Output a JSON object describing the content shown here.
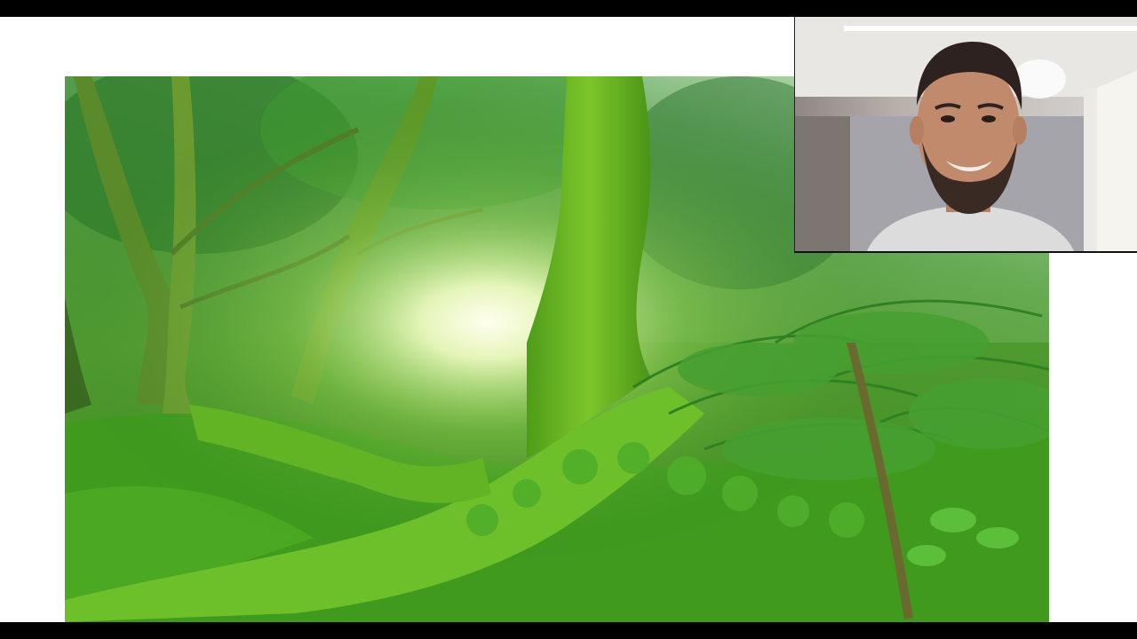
{
  "colors": {
    "letterbox": "#000000",
    "slide_background": "#ffffff",
    "moss": "#5fae1f",
    "fern": "#3f8f2a",
    "light": "#fffbe0"
  },
  "slide": {
    "image": "mossy-forest-photo"
  },
  "webcam": {
    "participant": "presenter-video"
  }
}
